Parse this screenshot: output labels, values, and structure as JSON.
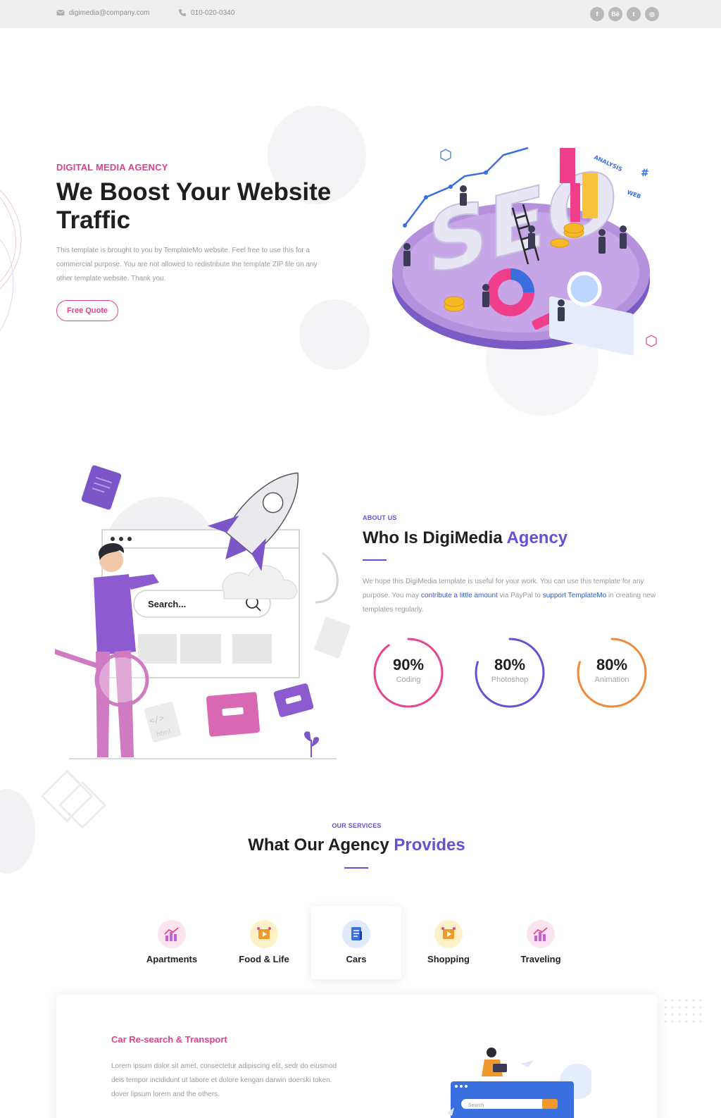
{
  "topbar": {
    "email": "digimedia@company.com",
    "phone": "010-020-0340",
    "socials": [
      {
        "label": "f",
        "icon": "facebook-icon"
      },
      {
        "label": "Bē",
        "icon": "behance-icon"
      },
      {
        "label": "t",
        "icon": "twitter-icon"
      },
      {
        "label": "◎",
        "icon": "dribbble-icon"
      }
    ]
  },
  "hero": {
    "eyebrow": "DIGITAL MEDIA AGENCY",
    "title_line1": "We Boost Your Website",
    "title_line2": "Traffic",
    "text": "This template is brought to you by TemplateMo website. Feel free to use this for a commercial purpose. You are not allowed to redistribute the template ZIP file on any other template website. Thank you.",
    "button": "Free Quote",
    "art_text": {
      "main": "SEO",
      "analysis": "ANALYSIS",
      "web": "WEB",
      "hash": "#"
    }
  },
  "about": {
    "eyebrow": "ABOUT US",
    "title_plain": "Who Is DigiMedia",
    "title_accent": "Agency",
    "text_1": "We hope this DigiMedia template is useful for your work. You can use this template for any purpose. You may",
    "link_1": "contribute a little amount",
    "text_2": "via PayPal to",
    "link_2": "support TemplateMo",
    "text_3": "in creating new templates regularly.",
    "search_placeholder": "Search...",
    "html_tag": "</>",
    "html_label": "html",
    "skills": [
      {
        "value": "90%",
        "label": "Coding",
        "percent": 90,
        "color": "#e8448d"
      },
      {
        "value": "80%",
        "label": "Photoshop",
        "percent": 80,
        "color": "#6a4fd6"
      },
      {
        "value": "80%",
        "label": "Animation",
        "percent": 80,
        "color": "#f08a3a"
      }
    ]
  },
  "services": {
    "eyebrow": "OUR SERVICES",
    "title_plain": "What Our Agency",
    "title_accent": "Provides",
    "tabs": [
      {
        "label": "Apartments",
        "icon": "chart-bars-icon"
      },
      {
        "label": "Food & Life",
        "icon": "media-play-icon"
      },
      {
        "label": "Cars",
        "icon": "document-icon"
      },
      {
        "label": "Shopping",
        "icon": "media-play-icon"
      },
      {
        "label": "Traveling",
        "icon": "chart-bars-icon"
      }
    ],
    "active_tab": "Cars",
    "card": {
      "title": "Car Re-search & Transport",
      "text": "Lorem ipsum dolor sit amet, consectetur adipiscing elit, sedr do eiusmod deis tempor incididunt ut labore et dolore kengan darwin doerski token. dover lipsum lorem and the others.",
      "search_placeholder": "Search"
    }
  },
  "colors": {
    "pink": "#e23f8e",
    "purple": "#6a4fd6",
    "orange": "#f08a3a",
    "link_blue": "#2e5bd6"
  }
}
